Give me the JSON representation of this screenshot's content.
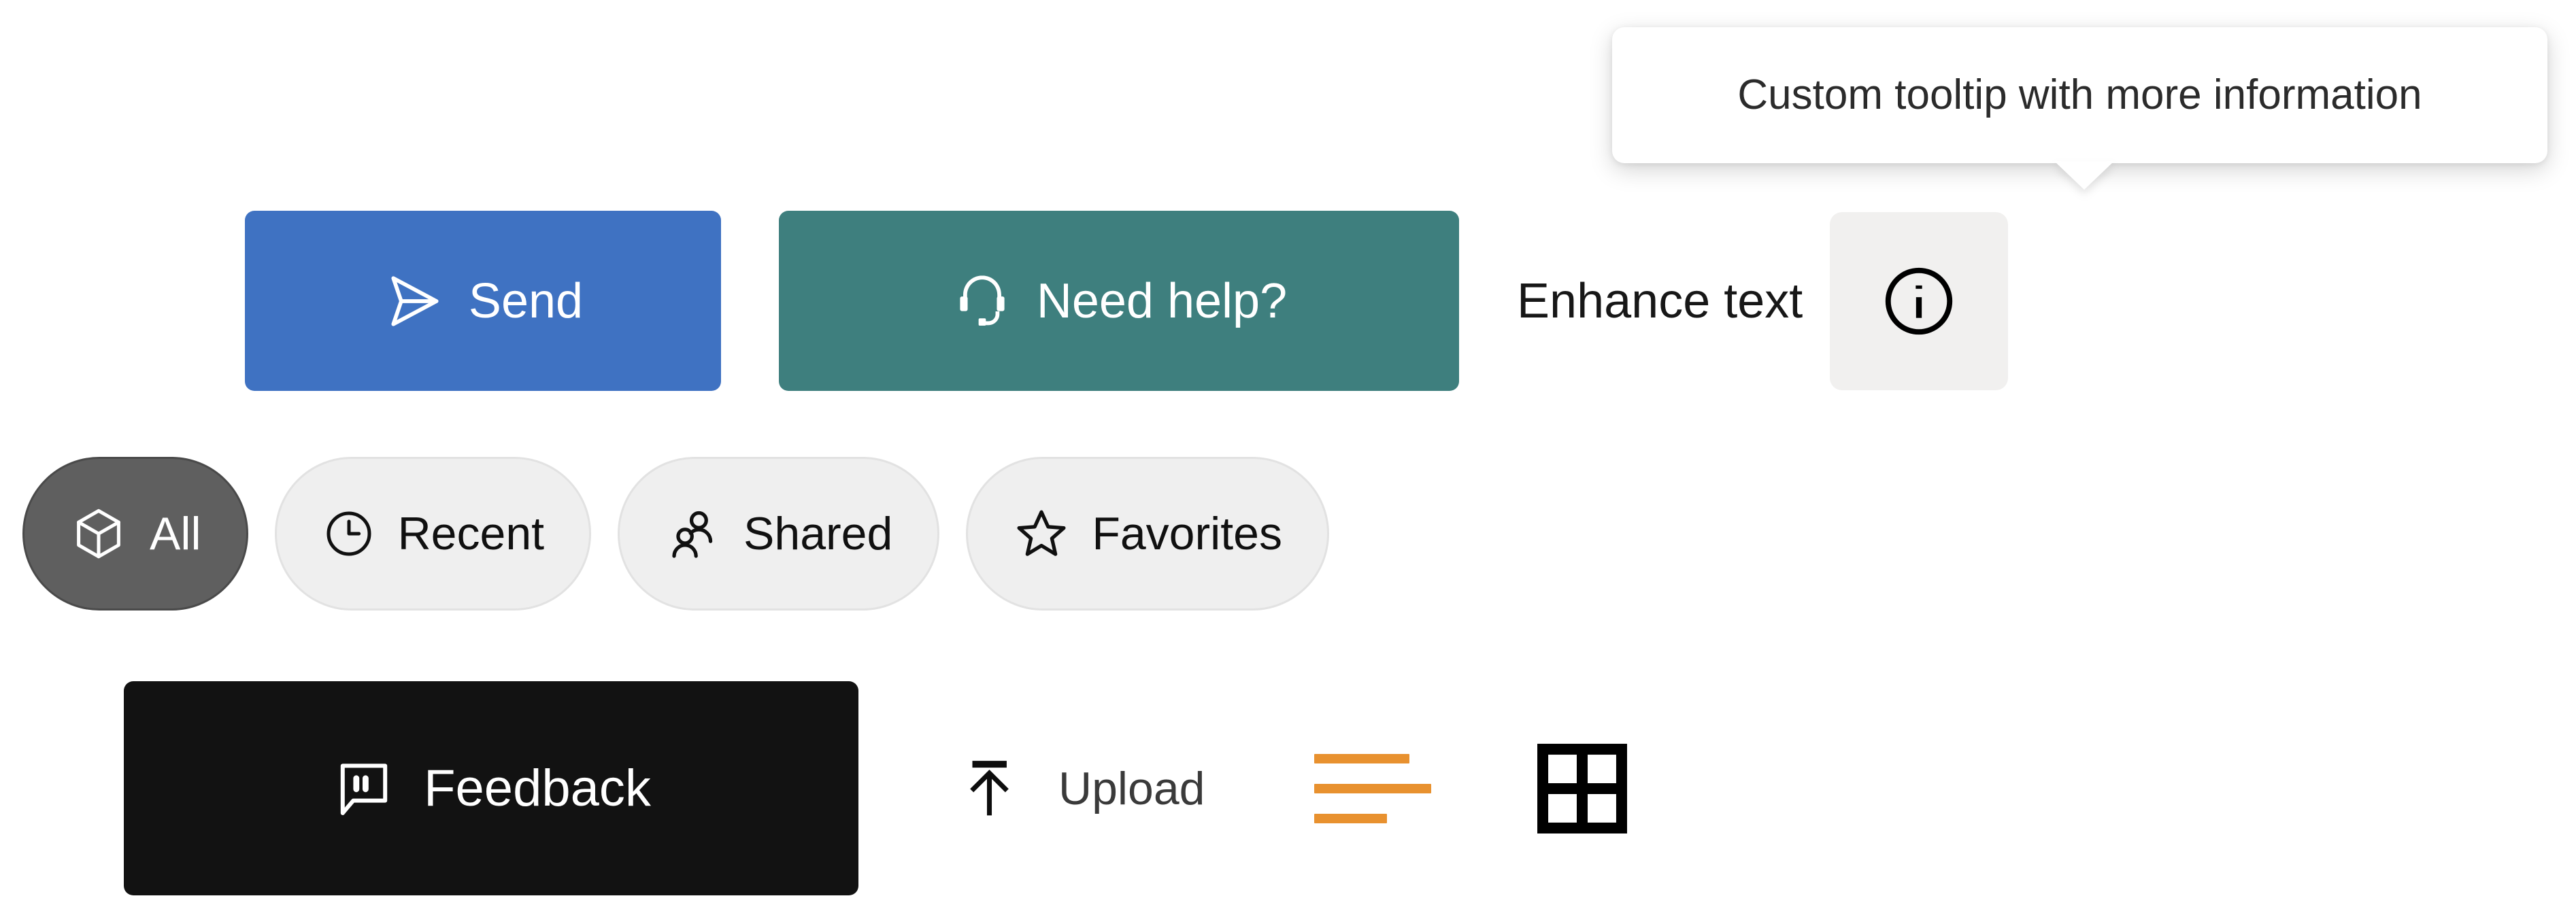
{
  "tooltip": {
    "text": "Custom tooltip with more information",
    "background": "#ffffff",
    "text_color": "#2b2b2b"
  },
  "actions": {
    "send": {
      "label": "Send",
      "icon": "send-icon",
      "background": "#3f72c2",
      "text_color": "#ffffff"
    },
    "need_help": {
      "label": "Need help?",
      "icon": "headset-icon",
      "background": "#3e7f7e",
      "text_color": "#ffffff"
    },
    "enhance_text": {
      "label": "Enhance text",
      "text_color": "#171717"
    },
    "info": {
      "icon": "info-circle-icon",
      "background": "#f1f0ef",
      "icon_color": "#000000"
    }
  },
  "filters": [
    {
      "label": "All",
      "icon": "cube-icon",
      "active": true,
      "background": "#5f5f5f",
      "text_color": "#ffffff"
    },
    {
      "label": "Recent",
      "icon": "clock-icon",
      "active": false,
      "background": "#efefef",
      "text_color": "#101010"
    },
    {
      "label": "Shared",
      "icon": "people-icon",
      "active": false,
      "background": "#efefef",
      "text_color": "#101010"
    },
    {
      "label": "Favorites",
      "icon": "star-icon",
      "active": false,
      "background": "#efefef",
      "text_color": "#101010"
    }
  ],
  "footer": {
    "feedback": {
      "label": "Feedback",
      "icon": "comment-quote-icon",
      "background": "#121212",
      "text_color": "#ffffff"
    },
    "upload": {
      "label": "Upload",
      "icon": "arrow-up-to-line-icon",
      "text_color": "#3a3a3a"
    },
    "list_view": {
      "icon": "list-lines-icon",
      "color": "#e8912f"
    },
    "grid_view": {
      "icon": "grid-2x2-icon",
      "color": "#000000"
    }
  }
}
